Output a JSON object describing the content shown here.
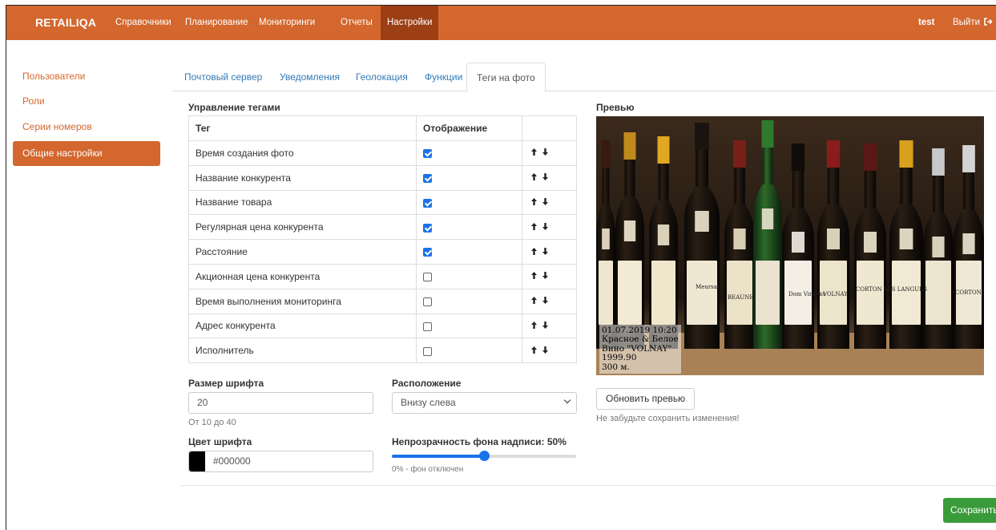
{
  "navbar": {
    "brand": "RETAILIQA",
    "items": [
      {
        "label": "Справочники"
      },
      {
        "label": "Планирование"
      },
      {
        "label": "Мониторинги"
      },
      {
        "label": "Отчеты"
      },
      {
        "label": "Настройки",
        "active": true
      }
    ],
    "user": "test",
    "logout_label": "Выйти",
    "logout_icon": "sign-out-icon",
    "bar_color": "#d3672e",
    "active_color": "#9c3f15"
  },
  "sidebar": {
    "items": [
      {
        "label": "Пользователи"
      },
      {
        "label": "Роли"
      },
      {
        "label": "Серии номеров"
      },
      {
        "label": "Общие настройки",
        "active": true
      }
    ]
  },
  "tabs": [
    {
      "label": "Почтовый сервер"
    },
    {
      "label": "Уведомления"
    },
    {
      "label": "Геолокация"
    },
    {
      "label": "Функции"
    },
    {
      "label": "Теги на фото",
      "active": true
    }
  ],
  "tag_management": {
    "title": "Управление тегами",
    "columns": [
      "Тег",
      "Отображение",
      ""
    ],
    "rows": [
      {
        "tag": "Время создания фото",
        "display": true
      },
      {
        "tag": "Название конкурента",
        "display": true
      },
      {
        "tag": "Название товара",
        "display": true
      },
      {
        "tag": "Регулярная цена конкурента",
        "display": true
      },
      {
        "tag": "Расстояние",
        "display": true
      },
      {
        "tag": "Акционная цена конкурента",
        "display": false
      },
      {
        "tag": "Время выполнения мониторинга",
        "display": false
      },
      {
        "tag": "Адрес конкурента",
        "display": false
      },
      {
        "tag": "Исполнитель",
        "display": false
      }
    ],
    "move_icons": "arrow-up-down-icon"
  },
  "font_size": {
    "label": "Размер шрифта",
    "value": "20",
    "help": "От 10 до 40"
  },
  "position": {
    "label": "Расположение",
    "value": "Внизу слева"
  },
  "font_color": {
    "label": "Цвет шрифта",
    "value": "#000000",
    "swatch": "#000000"
  },
  "opacity": {
    "label": "Непрозрачность фона надписи: 50%",
    "value_percent": 50,
    "help": "0% - фон отключен"
  },
  "preview": {
    "title": "Превью",
    "overlay_lines": [
      "01.07.2019 10:20",
      "Красное & Белое",
      "Вино \"VOLNAY\"",
      "1999.90",
      "300 м."
    ],
    "bottle_labels": [
      "Meursault",
      "BEAUNE",
      "Dom Vincent",
      "VOLNAY",
      "CORTON LES LANGUES",
      "CORTON LES LA"
    ],
    "refresh_label": "Обновить превью",
    "reminder": "Не забудьте сохранить изменения!"
  },
  "save_label": "Сохранить"
}
